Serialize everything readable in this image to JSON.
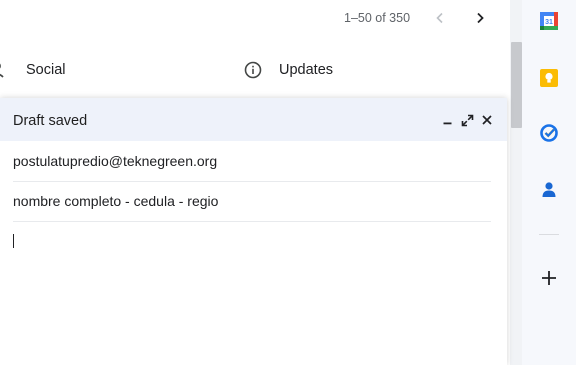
{
  "toolbar": {
    "pager_text": "1–50 of 350",
    "prev_icon": "chevron-left-icon",
    "next_icon": "chevron-right-icon"
  },
  "tabs": [
    {
      "label": "Social",
      "icon": "people-icon"
    },
    {
      "label": "Updates",
      "icon": "info-icon"
    }
  ],
  "compose": {
    "title": "Draft saved",
    "to_value": "postulatupredio@teknegreen.org",
    "subject_value": "nombre completo - cedula - regio",
    "body_value": "",
    "controls": [
      "minimize-icon",
      "expand-icon",
      "close-icon"
    ]
  },
  "sidepanel": {
    "apps": [
      "calendar-icon",
      "keep-icon",
      "tasks-icon",
      "contacts-icon"
    ],
    "calendar_day": "31",
    "add_icon": "plus-icon"
  },
  "colors": {
    "compose_header_bg": "#eef2fa",
    "sidepanel_bg": "#f6f8fc",
    "keep_yellow": "#fbbc04",
    "tasks_blue": "#1a73e8",
    "contacts_blue": "#1967d2"
  }
}
